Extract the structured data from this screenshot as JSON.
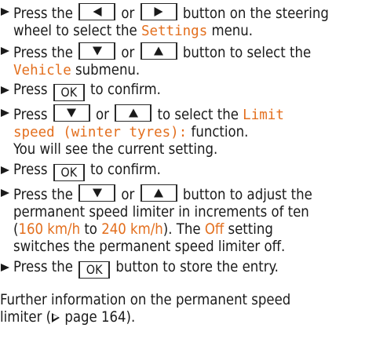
{
  "steps": [
    {
      "l1a": "Press the",
      "l1b": "or",
      "l1c": "button on the steering",
      "l2a": "wheel to select the",
      "l2menu": "Settings",
      "l2b": "menu."
    },
    {
      "l1a": "Press the",
      "l1b": "or",
      "l1c": "button to select the",
      "l2menu": "Vehicle",
      "l2b": "submenu."
    },
    {
      "a": "Press",
      "ok": "OK",
      "b": "to confirm."
    },
    {
      "l1a": "Press",
      "l1b": "or",
      "l1c": "to select the",
      "l1menu": "Limit",
      "l2menu": "speed (winter tyres):",
      "l2b": "function.",
      "l3": "You will see the current setting."
    },
    {
      "a": "Press",
      "ok": "OK",
      "b": "to confirm."
    },
    {
      "l1a": "Press the",
      "l1b": "or",
      "l1c": "button to adjust the",
      "l2": "permanent speed limiter in increments of ten",
      "l3open": "(",
      "l3v1": "160 km/h",
      "l3to": "to",
      "l3v2": "240 km/h",
      "l3c": "). The",
      "l3off": "Off",
      "l3d": "setting",
      "l4": "switches the permanent speed limiter off."
    },
    {
      "a": "Press the",
      "ok": "OK",
      "b": "button to store the entry."
    }
  ],
  "footer": {
    "l1": "Further information on the permanent speed",
    "l2a": "limiter (",
    "l2b": "page 164)."
  },
  "colors": {
    "highlight": "#e36f1e",
    "text": "#1a1a1a"
  },
  "icons": {
    "left": "triangle-left-icon",
    "right": "triangle-right-icon",
    "down": "triangle-down-icon",
    "up": "triangle-up-icon",
    "bullet": "bullet-arrow-icon",
    "ref": "page-reference-arrow-icon"
  }
}
